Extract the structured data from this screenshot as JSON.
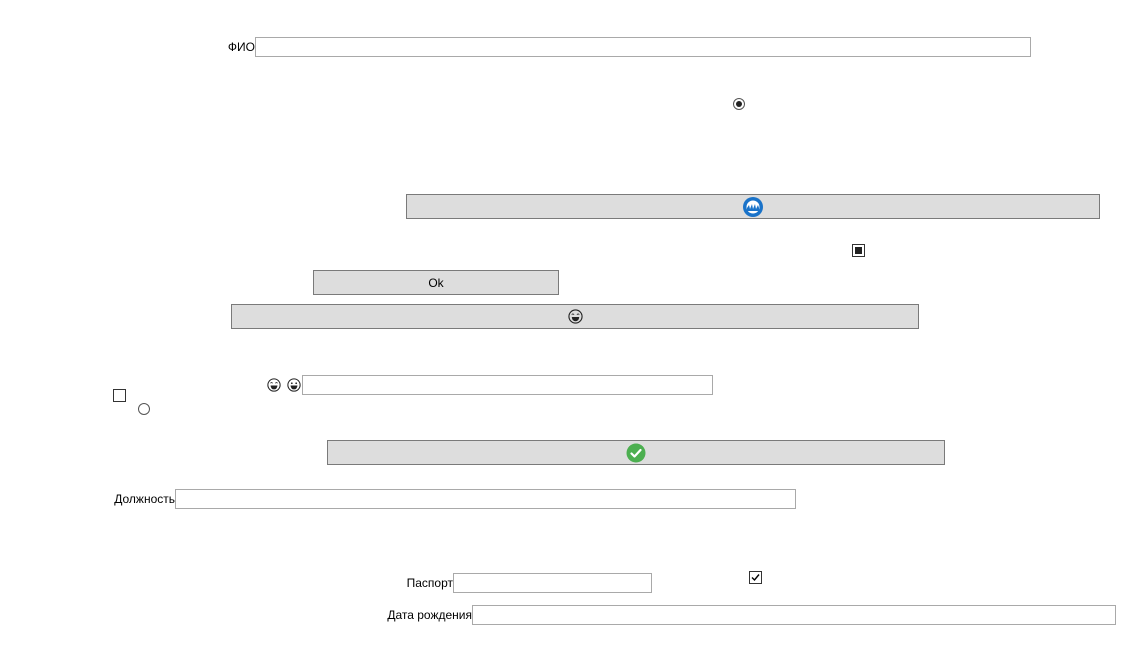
{
  "form": {
    "fio_label": "ФИО",
    "fio_value": "",
    "position_label": "Должность",
    "position_value": "",
    "passport_label": "Паспорт",
    "passport_value": "",
    "birthdate_label": "Дата рождения",
    "birthdate_value": "",
    "emoji_field_value": ""
  },
  "buttons": {
    "ok_label": "Ok"
  },
  "controls": {
    "radio_top_checked": true,
    "radio_left_checked": false,
    "checkbox_top_state": "indeterminate",
    "checkbox_left_checked": false,
    "checkbox_bottom_checked": true
  },
  "icons": {
    "wide_button_icon": "blue-fingerprint-icon",
    "emoji_button_icon": "laughing-emoji-icon",
    "field_emoji_1": "laughing-emoji-icon",
    "field_emoji_2": "grinning-emoji-icon",
    "confirm_button_icon": "green-checkmark-icon"
  },
  "colors": {
    "button_bg": "#dddddd",
    "accent_blue": "#1a73c9",
    "success_green": "#4caf50"
  }
}
